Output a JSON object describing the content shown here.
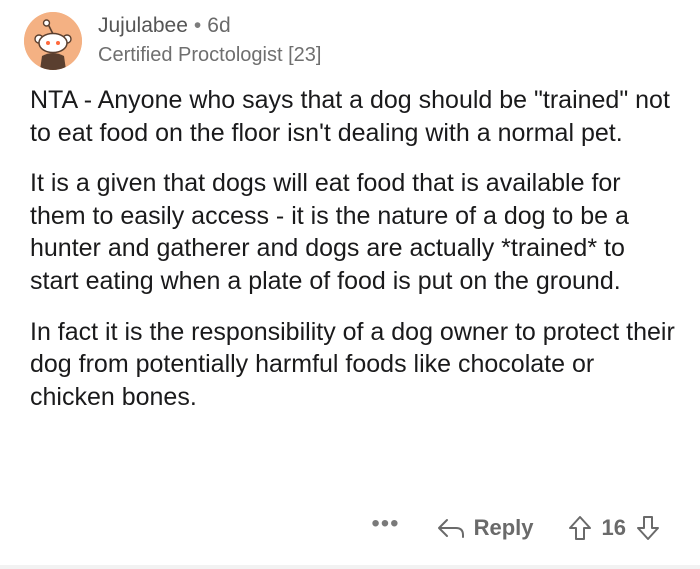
{
  "comment": {
    "username": "Jujulabee",
    "separator": "•",
    "age": "6d",
    "flair": "Certified Proctologist [23]",
    "paragraphs": [
      "NTA - Anyone who says that a dog should be \"trained\" not to eat food on the floor isn't dealing with a normal pet.",
      "It is a given that dogs will eat food that is available for them to easily access - it is the nature of a dog to be a hunter and gatherer and dogs are actually *trained* to start eating when a plate of food is put on the ground.",
      "In fact it is the responsibility of a dog owner to protect their dog from potentially harmful foods like chocolate or chicken bones."
    ],
    "actions": {
      "more_label": "•••",
      "reply_label": "Reply",
      "score": "16"
    }
  },
  "icons": {
    "avatar": "snoo-avatar-icon",
    "reply": "reply-arrow-icon",
    "upvote": "upvote-arrow-icon",
    "downvote": "downvote-arrow-icon"
  },
  "colors": {
    "avatar_bg": "#f4b183",
    "text": "#1a1a1b",
    "meta": "#6f6f6f"
  }
}
